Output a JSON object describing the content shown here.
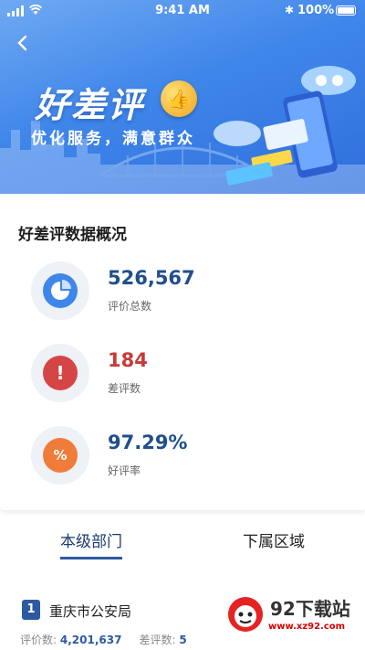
{
  "status_bar": {
    "time": "9:41 AM",
    "battery": "100%"
  },
  "header": {
    "back_icon": "chevron-left-icon",
    "title": "好差评",
    "subtitle": "优化服务，满意群众",
    "badge_icon": "thumbs-up-icon"
  },
  "overview": {
    "title": "好差评数据概况",
    "stats": [
      {
        "value": "526,567",
        "label": "评价总数",
        "icon": "pie-chart-icon",
        "color": "#3f86ea",
        "value_color": "#1f4f8c"
      },
      {
        "value": "184",
        "label": "差评数",
        "icon": "exclamation-icon",
        "color": "#d64545",
        "value_color": "#c83a3a"
      },
      {
        "value": "97.29%",
        "label": "好评率",
        "icon": "percent-icon",
        "color": "#f07c3a",
        "value_color": "#1f4f8c"
      }
    ]
  },
  "tabs": [
    {
      "label": "本级部门",
      "active": true
    },
    {
      "label": "下属区域",
      "active": false
    }
  ],
  "list": [
    {
      "rank": "1",
      "name": "重庆市公安局",
      "total_label": "评价数:",
      "total": "4,201,637",
      "bad_label": "差评数:",
      "bad": "5"
    }
  ],
  "watermark": {
    "title": "92下载站",
    "url": "www.xz92.com"
  }
}
